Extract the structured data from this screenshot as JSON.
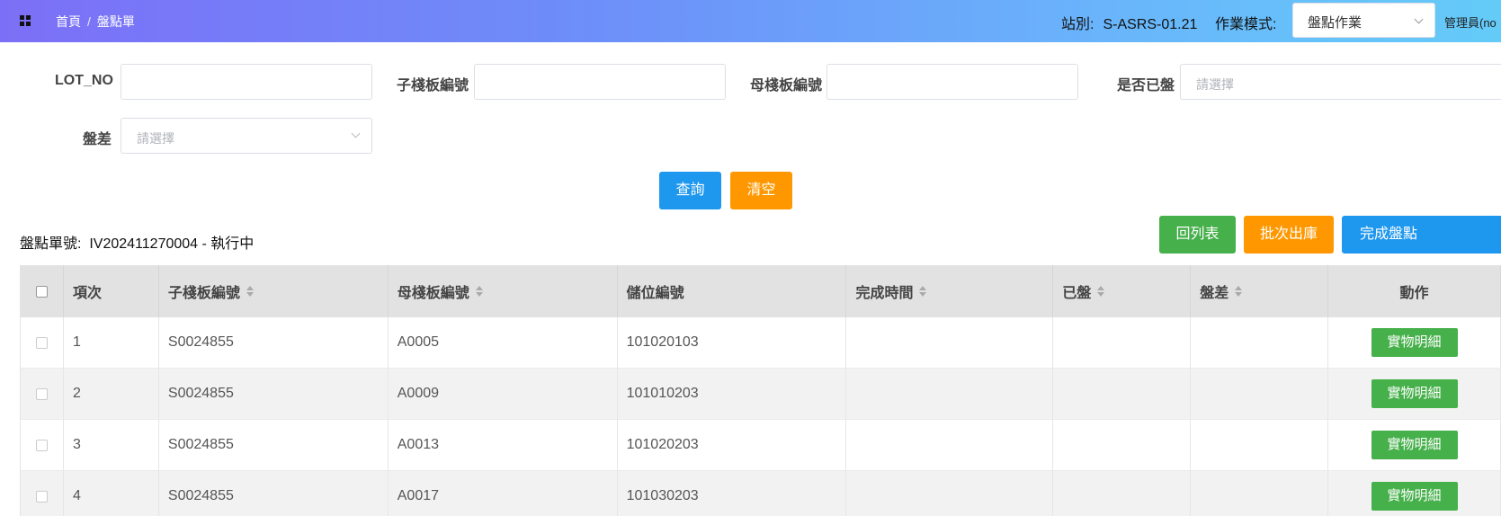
{
  "header": {
    "breadcrumb": [
      "首頁",
      "盤點單"
    ],
    "breadcrumb_sep": "/",
    "station_label": "站別:",
    "station_value": "S-ASRS-01.21",
    "mode_label": "作業模式:",
    "mode_value": "盤點作業",
    "user": "管理員(no"
  },
  "filters": {
    "lot_no_label": "LOT_NO",
    "child_board_label": "子棧板編號",
    "mother_board_label": "母棧板編號",
    "is_counted_label": "是否已盤",
    "is_counted_placeholder": "請選擇",
    "diff_label": "盤差",
    "diff_placeholder": "請選擇"
  },
  "actions": {
    "search": "查詢",
    "clear": "清空",
    "back_to_list": "回列表",
    "batch_outbound": "批次出庫",
    "complete": "完成盤點"
  },
  "order": {
    "label": "盤點單號:",
    "value": "IV202411270004 - 執行中"
  },
  "table": {
    "columns": [
      "項次",
      "子棧板編號",
      "母棧板編號",
      "儲位編號",
      "完成時間",
      "已盤",
      "盤差",
      "動作"
    ],
    "action_label": "實物明細",
    "rows": [
      {
        "no": "1",
        "child": "S0024855",
        "mother": "A0005",
        "location": "101020103",
        "done_time": "",
        "counted": "",
        "diff": ""
      },
      {
        "no": "2",
        "child": "S0024855",
        "mother": "A0009",
        "location": "101010203",
        "done_time": "",
        "counted": "",
        "diff": ""
      },
      {
        "no": "3",
        "child": "S0024855",
        "mother": "A0013",
        "location": "101020203",
        "done_time": "",
        "counted": "",
        "diff": ""
      },
      {
        "no": "4",
        "child": "S0024855",
        "mother": "A0017",
        "location": "101030203",
        "done_time": "",
        "counted": "",
        "diff": ""
      }
    ]
  }
}
